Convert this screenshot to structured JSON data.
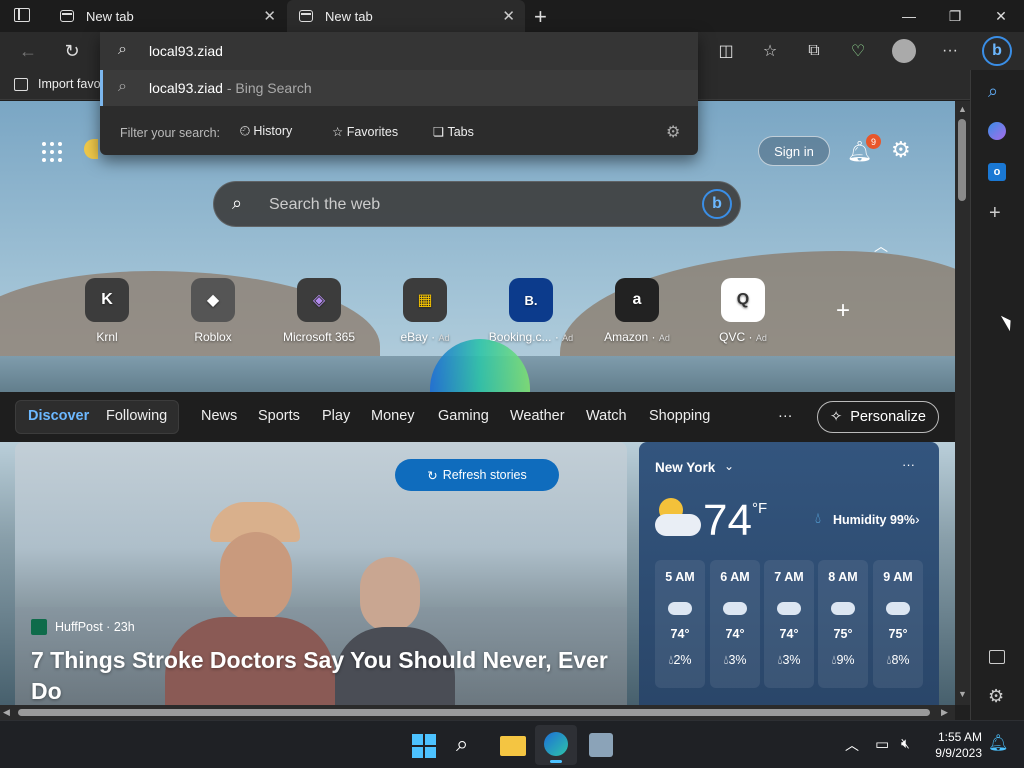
{
  "tabs": [
    {
      "label": "New tab",
      "active": false
    },
    {
      "label": "New tab",
      "active": true
    }
  ],
  "omnibox": {
    "query": "local93.ziad",
    "suggestion_text": "local93.ziad",
    "suggestion_suffix": " - Bing Search",
    "filter_label": "Filter your search:",
    "filters": [
      "History",
      "Favorites",
      "Tabs"
    ]
  },
  "favorites_bar": {
    "import_label": "Import favo"
  },
  "page": {
    "search_placeholder": "Search the web",
    "sign_in": "Sign in",
    "notification_count": "9",
    "shortcuts": [
      {
        "label": "Krnl",
        "ad": "",
        "glyph": "K"
      },
      {
        "label": "Roblox",
        "ad": "",
        "glyph": "◆"
      },
      {
        "label": "Microsoft 365",
        "ad": "",
        "glyph": "◈"
      },
      {
        "label": "eBay",
        "ad": "Ad",
        "glyph": "▦"
      },
      {
        "label": "Booking.c...",
        "ad": "Ad",
        "glyph": "B."
      },
      {
        "label": "Amazon",
        "ad": "Ad",
        "glyph": "a"
      },
      {
        "label": "QVC",
        "ad": "Ad",
        "glyph": "Q"
      }
    ],
    "nav": {
      "discover": "Discover",
      "following": "Following",
      "items": [
        "News",
        "Sports",
        "Play",
        "Money",
        "Gaming",
        "Weather",
        "Watch",
        "Shopping"
      ],
      "more": "···",
      "personalize": "Personalize"
    },
    "story": {
      "refresh": "Refresh stories",
      "source": "HuffPost · 23h",
      "headline_line1": "7 Things Stroke Doctors Say You Should Never, Ever",
      "headline_line2": "Do"
    },
    "weather": {
      "city": "New York",
      "temp": "74",
      "unit": "°F",
      "humidity": "Humidity 99%",
      "hours": [
        {
          "time": "5 AM",
          "temp": "74°",
          "precip": "2%"
        },
        {
          "time": "6 AM",
          "temp": "74°",
          "precip": "3%"
        },
        {
          "time": "7 AM",
          "temp": "74°",
          "precip": "3%"
        },
        {
          "time": "8 AM",
          "temp": "75°",
          "precip": "9%"
        },
        {
          "time": "9 AM",
          "temp": "75°",
          "precip": "8%"
        }
      ]
    }
  },
  "taskbar": {
    "time": "1:55 AM",
    "date": "9/9/2023"
  },
  "colors": {
    "accent": "#0f6cbd",
    "discover": "#6cb8ff",
    "badge": "#e8562a"
  }
}
